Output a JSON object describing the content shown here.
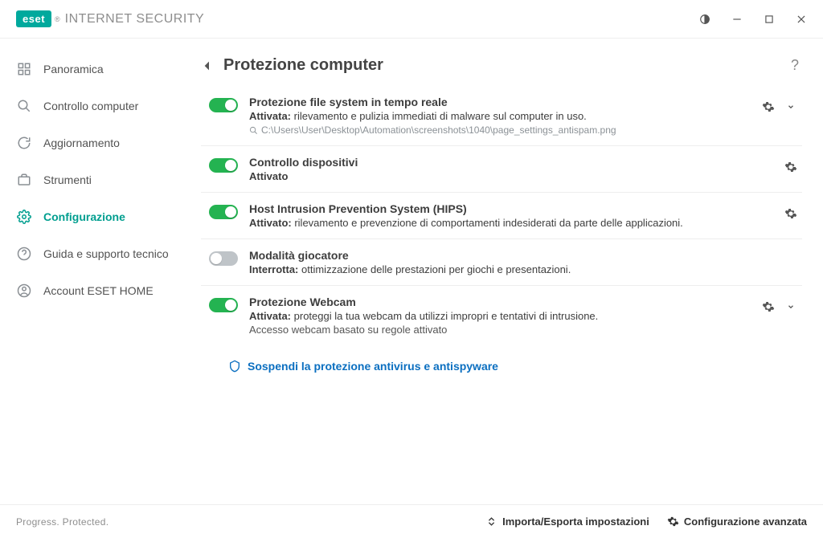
{
  "header": {
    "brand": "eset",
    "product": "INTERNET SECURITY"
  },
  "sidebar": {
    "items": [
      {
        "label": "Panoramica"
      },
      {
        "label": "Controllo computer"
      },
      {
        "label": "Aggiornamento"
      },
      {
        "label": "Strumenti"
      },
      {
        "label": "Configurazione"
      },
      {
        "label": "Guida e supporto tecnico"
      },
      {
        "label": "Account ESET HOME"
      }
    ]
  },
  "page": {
    "title": "Protezione computer"
  },
  "settings": [
    {
      "title": "Protezione file system in tempo reale",
      "status_label": "Attivata:",
      "status_desc": "rilevamento e pulizia immediati di malware sul computer in uso.",
      "extra": "C:\\Users\\User\\Desktop\\Automation\\screenshots\\1040\\page_settings_antispam.png"
    },
    {
      "title": "Controllo dispositivi",
      "status_label": "Attivato",
      "status_desc": ""
    },
    {
      "title": "Host Intrusion Prevention System (HIPS)",
      "status_label": "Attivato:",
      "status_desc": "rilevamento e prevenzione di comportamenti indesiderati da parte delle applicazioni."
    },
    {
      "title": "Modalità giocatore",
      "status_label": "Interrotta:",
      "status_desc": "ottimizzazione delle prestazioni per giochi e presentazioni."
    },
    {
      "title": "Protezione Webcam",
      "status_label": "Attivata:",
      "status_desc": "proteggi la tua webcam da utilizzi impropri e tentativi di intrusione.",
      "sub": "Accesso webcam basato su regole attivato"
    }
  ],
  "suspend_link": "Sospendi la protezione antivirus e antispyware",
  "footer": {
    "slogan": "Progress. Protected.",
    "import_export": "Importa/Esporta impostazioni",
    "advanced": "Configurazione avanzata"
  }
}
